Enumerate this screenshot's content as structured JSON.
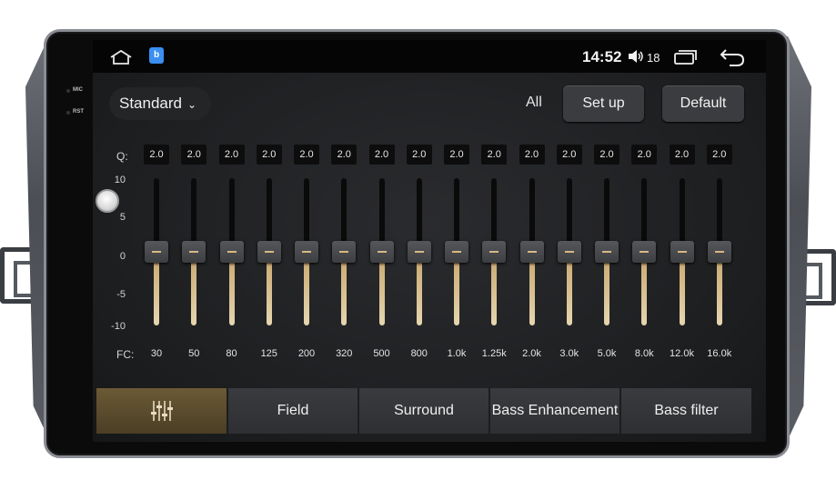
{
  "status_bar": {
    "time": "14:52",
    "volume_level": "18",
    "icons": [
      "home-icon",
      "app-icon",
      "volume-icon",
      "recent-apps-icon",
      "back-icon"
    ]
  },
  "side_labels": {
    "mic": "MIC",
    "rst": "RST"
  },
  "toolbar": {
    "preset_label": "Standard",
    "all_label": "All",
    "setup_label": "Set up",
    "default_label": "Default"
  },
  "eq": {
    "q_label": "Q:",
    "fc_label": "FC:",
    "db_labels": [
      "10",
      "5",
      "0",
      "-5",
      "-10"
    ],
    "bands": [
      {
        "fc": "30",
        "q": "2.0",
        "gain": 0
      },
      {
        "fc": "50",
        "q": "2.0",
        "gain": 0
      },
      {
        "fc": "80",
        "q": "2.0",
        "gain": 0
      },
      {
        "fc": "125",
        "q": "2.0",
        "gain": 0
      },
      {
        "fc": "200",
        "q": "2.0",
        "gain": 0
      },
      {
        "fc": "320",
        "q": "2.0",
        "gain": 0
      },
      {
        "fc": "500",
        "q": "2.0",
        "gain": 0
      },
      {
        "fc": "800",
        "q": "2.0",
        "gain": 0
      },
      {
        "fc": "1.0k",
        "q": "2.0",
        "gain": 0
      },
      {
        "fc": "1.25k",
        "q": "2.0",
        "gain": 0
      },
      {
        "fc": "2.0k",
        "q": "2.0",
        "gain": 0
      },
      {
        "fc": "3.0k",
        "q": "2.0",
        "gain": 0
      },
      {
        "fc": "5.0k",
        "q": "2.0",
        "gain": 0
      },
      {
        "fc": "8.0k",
        "q": "2.0",
        "gain": 0
      },
      {
        "fc": "12.0k",
        "q": "2.0",
        "gain": 0
      },
      {
        "fc": "16.0k",
        "q": "2.0",
        "gain": 0
      }
    ],
    "gain_range": [
      -10,
      10
    ]
  },
  "tabs": [
    {
      "label": "",
      "icon": "equalizer-icon",
      "active": true
    },
    {
      "label": "Field",
      "active": false
    },
    {
      "label": "Surround",
      "active": false
    },
    {
      "label": "Bass Enhancement",
      "active": false
    },
    {
      "label": "Bass filter",
      "active": false
    }
  ],
  "colors": {
    "accent": "#d9c294",
    "active_tab": "#5a4b2e",
    "screen_bg": "#222326"
  }
}
